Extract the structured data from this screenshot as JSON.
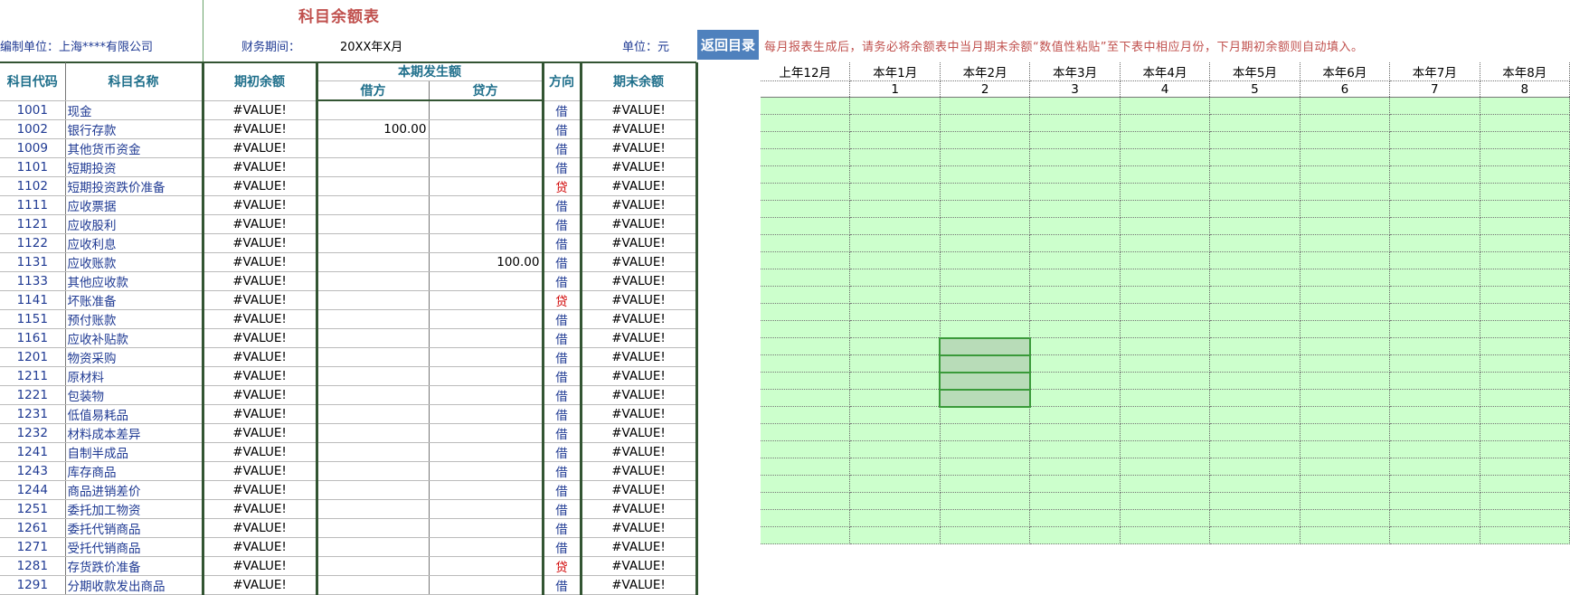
{
  "title": "科目余额表",
  "header": {
    "company": "编制单位：上海****有限公司",
    "period_label": "财务期间：",
    "period_value": "20XX年X月",
    "unit": "单位：元"
  },
  "back_button": "返回目录",
  "notice": "每月报表生成后，请务必将余额表中当月期末余额“数值性粘贴”至下表中相应月份，下月期初余额则自动填入。",
  "columns": {
    "code": "科目代码",
    "name": "科目名称",
    "opening": "期初余额",
    "current": "本期发生额",
    "debit": "借方",
    "credit": "贷方",
    "direction": "方向",
    "closing": "期末余额"
  },
  "rows": [
    {
      "code": "1001",
      "name": "现金",
      "opening": "#VALUE!",
      "debit": "",
      "credit": "",
      "dir": "借",
      "closing": "#VALUE!"
    },
    {
      "code": "1002",
      "name": "银行存款",
      "opening": "#VALUE!",
      "debit": "100.00",
      "credit": "",
      "dir": "借",
      "closing": "#VALUE!"
    },
    {
      "code": "1009",
      "name": "其他货币资金",
      "opening": "#VALUE!",
      "debit": "",
      "credit": "",
      "dir": "借",
      "closing": "#VALUE!"
    },
    {
      "code": "1101",
      "name": "短期投资",
      "opening": "#VALUE!",
      "debit": "",
      "credit": "",
      "dir": "借",
      "closing": "#VALUE!"
    },
    {
      "code": "1102",
      "name": "短期投资跌价准备",
      "opening": "#VALUE!",
      "debit": "",
      "credit": "",
      "dir": "贷",
      "closing": "#VALUE!"
    },
    {
      "code": "1111",
      "name": "应收票据",
      "opening": "#VALUE!",
      "debit": "",
      "credit": "",
      "dir": "借",
      "closing": "#VALUE!"
    },
    {
      "code": "1121",
      "name": "应收股利",
      "opening": "#VALUE!",
      "debit": "",
      "credit": "",
      "dir": "借",
      "closing": "#VALUE!"
    },
    {
      "code": "1122",
      "name": "应收利息",
      "opening": "#VALUE!",
      "debit": "",
      "credit": "",
      "dir": "借",
      "closing": "#VALUE!"
    },
    {
      "code": "1131",
      "name": "应收账款",
      "opening": "#VALUE!",
      "debit": "",
      "credit": "100.00",
      "dir": "借",
      "closing": "#VALUE!"
    },
    {
      "code": "1133",
      "name": "其他应收款",
      "opening": "#VALUE!",
      "debit": "",
      "credit": "",
      "dir": "借",
      "closing": "#VALUE!"
    },
    {
      "code": "1141",
      "name": "坏账准备",
      "opening": "#VALUE!",
      "debit": "",
      "credit": "",
      "dir": "贷",
      "closing": "#VALUE!"
    },
    {
      "code": "1151",
      "name": "预付账款",
      "opening": "#VALUE!",
      "debit": "",
      "credit": "",
      "dir": "借",
      "closing": "#VALUE!"
    },
    {
      "code": "1161",
      "name": "应收补贴款",
      "opening": "#VALUE!",
      "debit": "",
      "credit": "",
      "dir": "借",
      "closing": "#VALUE!"
    },
    {
      "code": "1201",
      "name": "物资采购",
      "opening": "#VALUE!",
      "debit": "",
      "credit": "",
      "dir": "借",
      "closing": "#VALUE!"
    },
    {
      "code": "1211",
      "name": "原材料",
      "opening": "#VALUE!",
      "debit": "",
      "credit": "",
      "dir": "借",
      "closing": "#VALUE!"
    },
    {
      "code": "1221",
      "name": "包装物",
      "opening": "#VALUE!",
      "debit": "",
      "credit": "",
      "dir": "借",
      "closing": "#VALUE!"
    },
    {
      "code": "1231",
      "name": "低值易耗品",
      "opening": "#VALUE!",
      "debit": "",
      "credit": "",
      "dir": "借",
      "closing": "#VALUE!"
    },
    {
      "code": "1232",
      "name": "材料成本差异",
      "opening": "#VALUE!",
      "debit": "",
      "credit": "",
      "dir": "借",
      "closing": "#VALUE!"
    },
    {
      "code": "1241",
      "name": "自制半成品",
      "opening": "#VALUE!",
      "debit": "",
      "credit": "",
      "dir": "借",
      "closing": "#VALUE!"
    },
    {
      "code": "1243",
      "name": "库存商品",
      "opening": "#VALUE!",
      "debit": "",
      "credit": "",
      "dir": "借",
      "closing": "#VALUE!"
    },
    {
      "code": "1244",
      "name": "商品进销差价",
      "opening": "#VALUE!",
      "debit": "",
      "credit": "",
      "dir": "借",
      "closing": "#VALUE!"
    },
    {
      "code": "1251",
      "name": "委托加工物资",
      "opening": "#VALUE!",
      "debit": "",
      "credit": "",
      "dir": "借",
      "closing": "#VALUE!"
    },
    {
      "code": "1261",
      "name": "委托代销商品",
      "opening": "#VALUE!",
      "debit": "",
      "credit": "",
      "dir": "借",
      "closing": "#VALUE!"
    },
    {
      "code": "1271",
      "name": "受托代销商品",
      "opening": "#VALUE!",
      "debit": "",
      "credit": "",
      "dir": "借",
      "closing": "#VALUE!"
    },
    {
      "code": "1281",
      "name": "存货跌价准备",
      "opening": "#VALUE!",
      "debit": "",
      "credit": "",
      "dir": "贷",
      "closing": "#VALUE!"
    },
    {
      "code": "1291",
      "name": "分期收款发出商品",
      "opening": "#VALUE!",
      "debit": "",
      "credit": "",
      "dir": "借",
      "closing": "#VALUE!"
    }
  ],
  "months": [
    {
      "label": "上年12月",
      "num": ""
    },
    {
      "label": "本年1月",
      "num": "1"
    },
    {
      "label": "本年2月",
      "num": "2"
    },
    {
      "label": "本年3月",
      "num": "3"
    },
    {
      "label": "本年4月",
      "num": "4"
    },
    {
      "label": "本年5月",
      "num": "5"
    },
    {
      "label": "本年6月",
      "num": "6"
    },
    {
      "label": "本年7月",
      "num": "7"
    },
    {
      "label": "本年8月",
      "num": "8"
    }
  ],
  "colors": {
    "grid_fill": "#ccffcc",
    "title": "#c0504d",
    "text_blue": "#1f3a93",
    "credit_red": "#d00000",
    "button": "#4f81bd"
  }
}
